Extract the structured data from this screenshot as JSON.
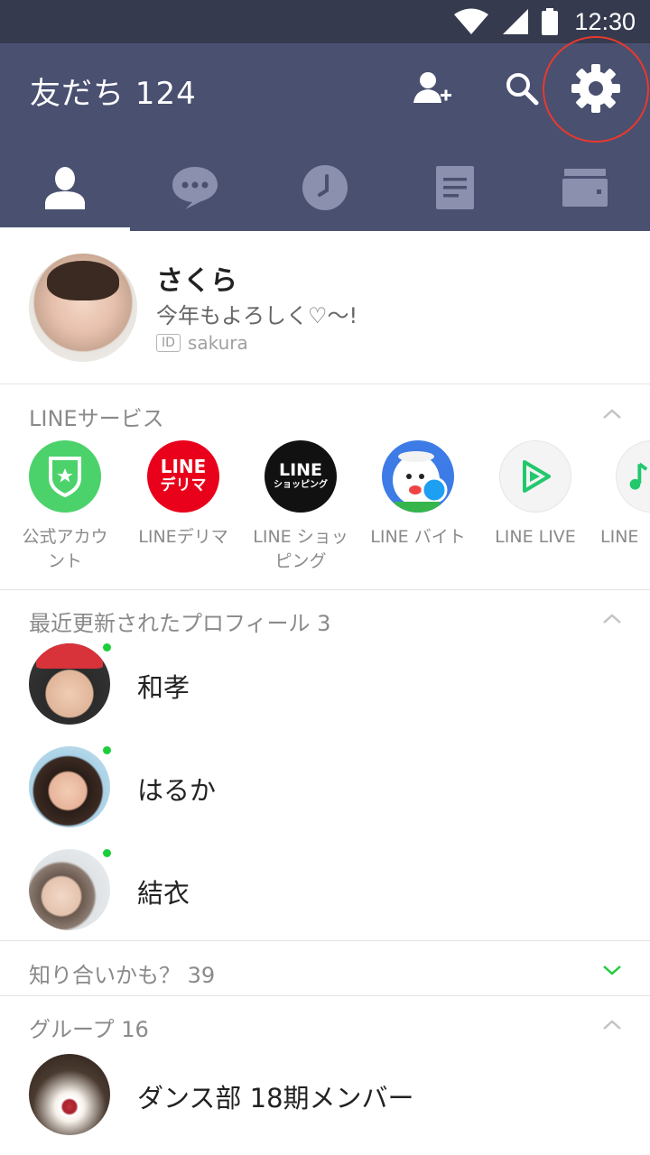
{
  "status_bar": {
    "time": "12:30",
    "icons": [
      "wifi-icon",
      "signal-icon",
      "battery-icon"
    ]
  },
  "header": {
    "title": "友だち 124",
    "actions": [
      "add-friend-icon",
      "search-icon",
      "gear-icon"
    ]
  },
  "tabs": [
    {
      "icon": "friends-icon",
      "active": true
    },
    {
      "icon": "chat-icon",
      "active": false
    },
    {
      "icon": "timeline-icon",
      "active": false
    },
    {
      "icon": "news-icon",
      "active": false
    },
    {
      "icon": "wallet-icon",
      "active": false
    }
  ],
  "profile": {
    "name": "さくら",
    "status": "今年もよろしく♡〜!",
    "id_badge": "ID",
    "id": "sakura"
  },
  "services": {
    "header": "LINEサービス",
    "items": [
      {
        "label": "公式アカウ\nント",
        "icon": "official-account-icon"
      },
      {
        "label": "LINEデリマ",
        "icon": "line-delima-icon",
        "logo_top": "LINE",
        "logo_bottom": "デリマ"
      },
      {
        "label": "LINE ショッ\nピング",
        "icon": "line-shopping-icon",
        "logo_top": "LINE",
        "logo_bottom": "ショッピング"
      },
      {
        "label": "LINE バイト",
        "icon": "line-baito-icon"
      },
      {
        "label": "LINE LIVE",
        "icon": "line-live-icon"
      },
      {
        "label": "LINE",
        "icon": "line-music-icon"
      }
    ]
  },
  "recent_profiles": {
    "header": "最近更新されたプロフィール 3",
    "items": [
      {
        "name": "和孝"
      },
      {
        "name": "はるか"
      },
      {
        "name": "結衣"
      }
    ]
  },
  "suggestions": {
    "header": "知り合いかも？ 39"
  },
  "groups": {
    "header": "グループ 16",
    "items": [
      {
        "name": "ダンス部 18期メンバー"
      }
    ]
  },
  "colors": {
    "header_bg": "#4a5070",
    "status_bg": "#353a4e",
    "accent_green": "#1dce3b",
    "highlight_ring": "#e8392e"
  }
}
